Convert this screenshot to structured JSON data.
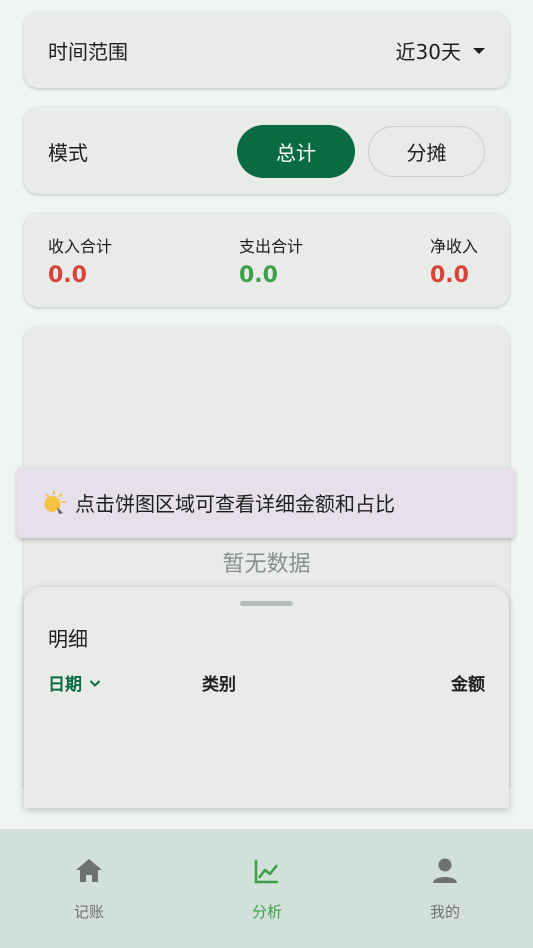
{
  "time_range": {
    "label": "时间范围",
    "value": "近30天"
  },
  "mode": {
    "label": "模式",
    "options": [
      "总计",
      "分摊"
    ],
    "selected": "总计"
  },
  "summary": {
    "income": {
      "label": "收入合计",
      "value": "0.0"
    },
    "expense": {
      "label": "支出合计",
      "value": "0.0"
    },
    "net": {
      "label": "净收入",
      "value": "0.0"
    }
  },
  "tip": {
    "text": "点击饼图区域可查看详细金额和占比",
    "icon": "bulb-icon"
  },
  "chart": {
    "empty_text": "暂无数据"
  },
  "details": {
    "title": "明细",
    "columns": {
      "date": "日期",
      "category": "类别",
      "amount": "金额"
    }
  },
  "nav": {
    "items": [
      {
        "label": "记账",
        "icon": "home-icon"
      },
      {
        "label": "分析",
        "icon": "chart-icon",
        "active": true
      },
      {
        "label": "我的",
        "icon": "person-icon"
      }
    ]
  },
  "colors": {
    "primary": "#0a6b43",
    "income": "#d8433b",
    "expense": "#3fa04a",
    "nav_active": "#3fa04a"
  }
}
